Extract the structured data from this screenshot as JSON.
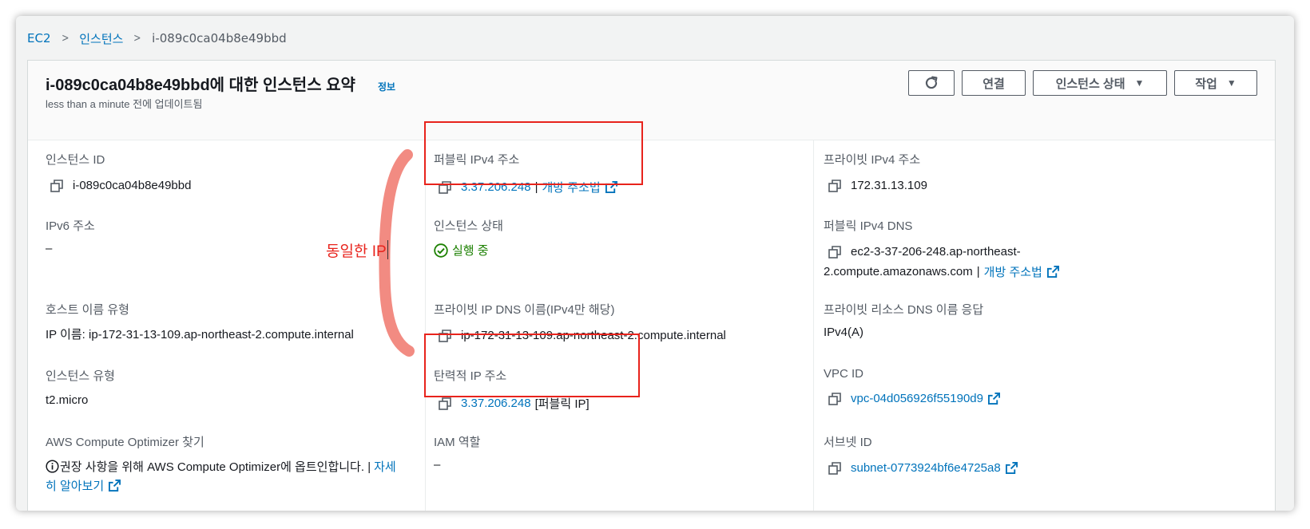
{
  "breadcrumb": {
    "items": [
      "EC2",
      "인스턴스"
    ],
    "current": "i-089c0ca04b8e49bbd"
  },
  "header": {
    "title": "i-089c0ca04b8e49bbd에 대한 인스턴스 요약",
    "info": "정보",
    "subtitle": "less than a minute 전에 업데이트됨"
  },
  "actions": {
    "connect": "연결",
    "instance_state": "인스턴스 상태",
    "actions": "작업"
  },
  "fields": {
    "instance_id": {
      "label": "인스턴스 ID",
      "value": "i-089c0ca04b8e49bbd"
    },
    "ipv6": {
      "label": "IPv6 주소",
      "value": "–"
    },
    "hostname_type": {
      "label": "호스트 이름 유형",
      "value": "IP 이름: ip-172-31-13-109.ap-northeast-2.compute.internal"
    },
    "instance_type": {
      "label": "인스턴스 유형",
      "value": "t2.micro"
    },
    "optimizer": {
      "label": "AWS Compute Optimizer 찾기",
      "text": "권장 사항을 위해 AWS Compute Optimizer에 옵트인합니다. |",
      "link1": "자세",
      "link2": "히 알아보기"
    },
    "public_ipv4": {
      "label": "퍼블릭 IPv4 주소",
      "value": "3.37.206.248",
      "sep": "|",
      "link": "개방 주소법"
    },
    "instance_state": {
      "label": "인스턴스 상태",
      "value": "실행 중"
    },
    "private_dns_name": {
      "label": "프라이빗 IP DNS 이름(IPv4만 해당)",
      "value": "ip-172-31-13-109.ap-northeast-2.compute.internal"
    },
    "elastic_ip": {
      "label": "탄력적 IP 주소",
      "value": "3.37.206.248",
      "suffix": "[퍼블릭 IP]"
    },
    "iam_role": {
      "label": "IAM 역할",
      "value": "–"
    },
    "private_ipv4": {
      "label": "프라이빗 IPv4 주소",
      "value": "172.31.13.109"
    },
    "public_dns": {
      "label": "퍼블릭 IPv4 DNS",
      "value_line1": "ec2-3-37-206-248.ap-northeast-",
      "value_line2": "2.compute.amazonaws.com",
      "sep": "|",
      "link": "개방 주소법"
    },
    "resource_dns": {
      "label": "프라이빗 리소스 DNS 이름 응답",
      "value": "IPv4(A)"
    },
    "vpc_id": {
      "label": "VPC ID",
      "value": "vpc-04d056926f55190d9"
    },
    "subnet_id": {
      "label": "서브넷 ID",
      "value": "subnet-0773924bf6e4725a8"
    }
  },
  "annotation": {
    "text": "동일한 IP",
    "color": "#e8231c",
    "arc_color": "#f28b82"
  },
  "colors": {
    "link": "#0073bb",
    "status_ok": "#1d8102",
    "label": "#545b64"
  },
  "icons": [
    "refresh-icon",
    "caret-down-icon",
    "copy-icon",
    "external-link-icon",
    "check-circle-icon",
    "info-circle-icon",
    "chevron-right-icon"
  ]
}
